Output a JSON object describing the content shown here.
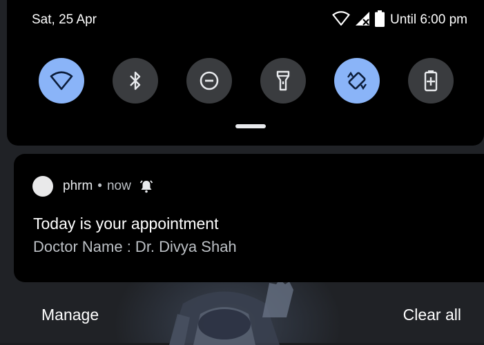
{
  "status_bar": {
    "date": "Sat, 25 Apr",
    "battery_label": "Until 6:00 pm",
    "icons": [
      "wifi-icon",
      "signal-icon",
      "battery-icon"
    ]
  },
  "quick_tiles": [
    {
      "name": "wifi",
      "icon": "wifi-icon",
      "state": "on"
    },
    {
      "name": "bluetooth",
      "icon": "bluetooth-icon",
      "state": "off"
    },
    {
      "name": "do-not-disturb",
      "icon": "dnd-icon",
      "state": "off"
    },
    {
      "name": "flashlight",
      "icon": "flashlight-icon",
      "state": "off"
    },
    {
      "name": "auto-rotate",
      "icon": "rotate-icon",
      "state": "on"
    },
    {
      "name": "battery-saver",
      "icon": "battery-saver-icon",
      "state": "off"
    }
  ],
  "notification": {
    "app_name": "phrm",
    "separator": "•",
    "time": "now",
    "title": "Today is your appointment",
    "text": "Doctor Name : Dr. Divya Shah"
  },
  "actions": {
    "manage": "Manage",
    "clear_all": "Clear all"
  },
  "colors": {
    "tile_on": "#8ab4f8",
    "tile_off": "#3a3c3f",
    "panel_bg": "#000000"
  }
}
